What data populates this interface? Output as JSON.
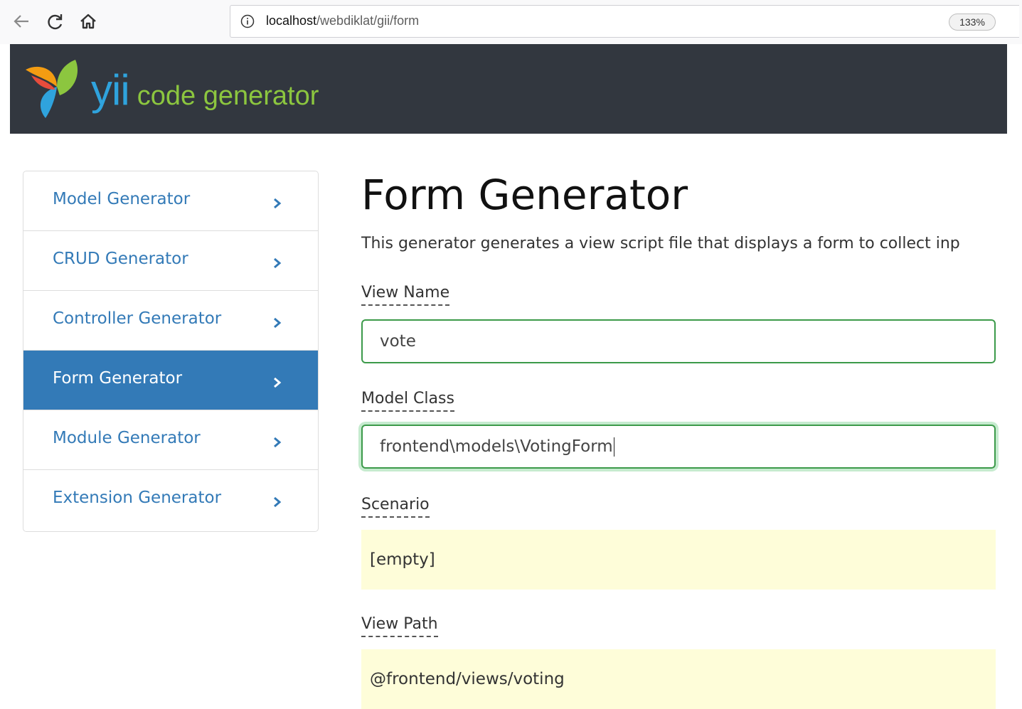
{
  "browser": {
    "url_host": "localhost",
    "url_path": "/webdiklat/gii/form",
    "zoom": "133%"
  },
  "header": {
    "logo_word": "yii",
    "logo_subtitle": "code generator"
  },
  "sidebar": {
    "items": [
      {
        "label": "Model Generator",
        "active": false
      },
      {
        "label": "CRUD Generator",
        "active": false
      },
      {
        "label": "Controller Generator",
        "active": false
      },
      {
        "label": "Form Generator",
        "active": true
      },
      {
        "label": "Module Generator",
        "active": false
      },
      {
        "label": "Extension Generator",
        "active": false
      }
    ]
  },
  "main": {
    "title": "Form Generator",
    "description": "This generator generates a view script file that displays a form to collect inp",
    "fields": {
      "view_name": {
        "label": "View Name",
        "value": "vote"
      },
      "model_class": {
        "label": "Model Class",
        "value": "frontend\\models\\VotingForm"
      },
      "scenario": {
        "label": "Scenario",
        "value": "[empty]"
      },
      "view_path": {
        "label": "View Path",
        "value": "@frontend/views/voting"
      }
    }
  },
  "colors": {
    "header_bg": "#32373f",
    "link": "#337ab7",
    "active_bg": "#337ab7",
    "input_border": "#3c9a4a",
    "readonly_bg": "#fefdd9"
  },
  "icons": [
    "back-arrow-icon",
    "reload-icon",
    "home-icon",
    "info-icon",
    "chevron-right-icon",
    "yii-logo"
  ]
}
